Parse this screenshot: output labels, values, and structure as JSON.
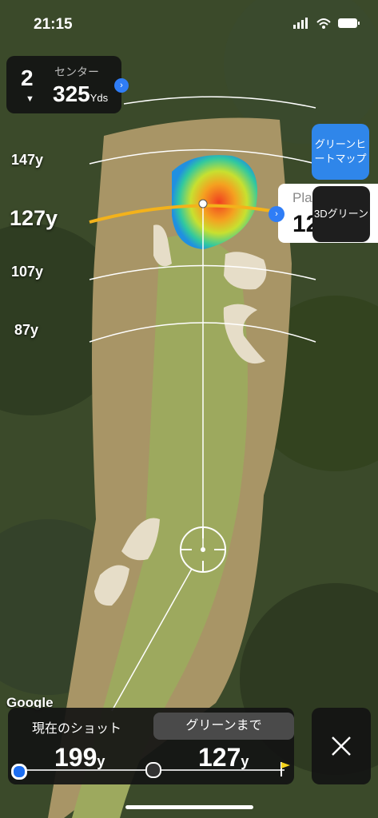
{
  "status": {
    "time": "21:15"
  },
  "hole": {
    "number": "2",
    "caret": "▼",
    "label": "センター",
    "distance": "325",
    "unit": "Yds"
  },
  "distance_markers": [
    "147y",
    "127y",
    "107y",
    "87y"
  ],
  "buttons": {
    "green_heatmap": "グリーンヒートマップ",
    "green_3d": "3Dグリーン"
  },
  "plays_like": {
    "label": "Pla",
    "value": "12"
  },
  "attribution": "Google",
  "bottom": {
    "current_shot_label": "現在のショット",
    "to_green_label": "グリーンまで",
    "current_shot_value": "199",
    "to_green_value": "127",
    "unit": "y"
  },
  "colors": {
    "accent_blue": "#2f86ea",
    "aim_line": "#f3b21b"
  }
}
